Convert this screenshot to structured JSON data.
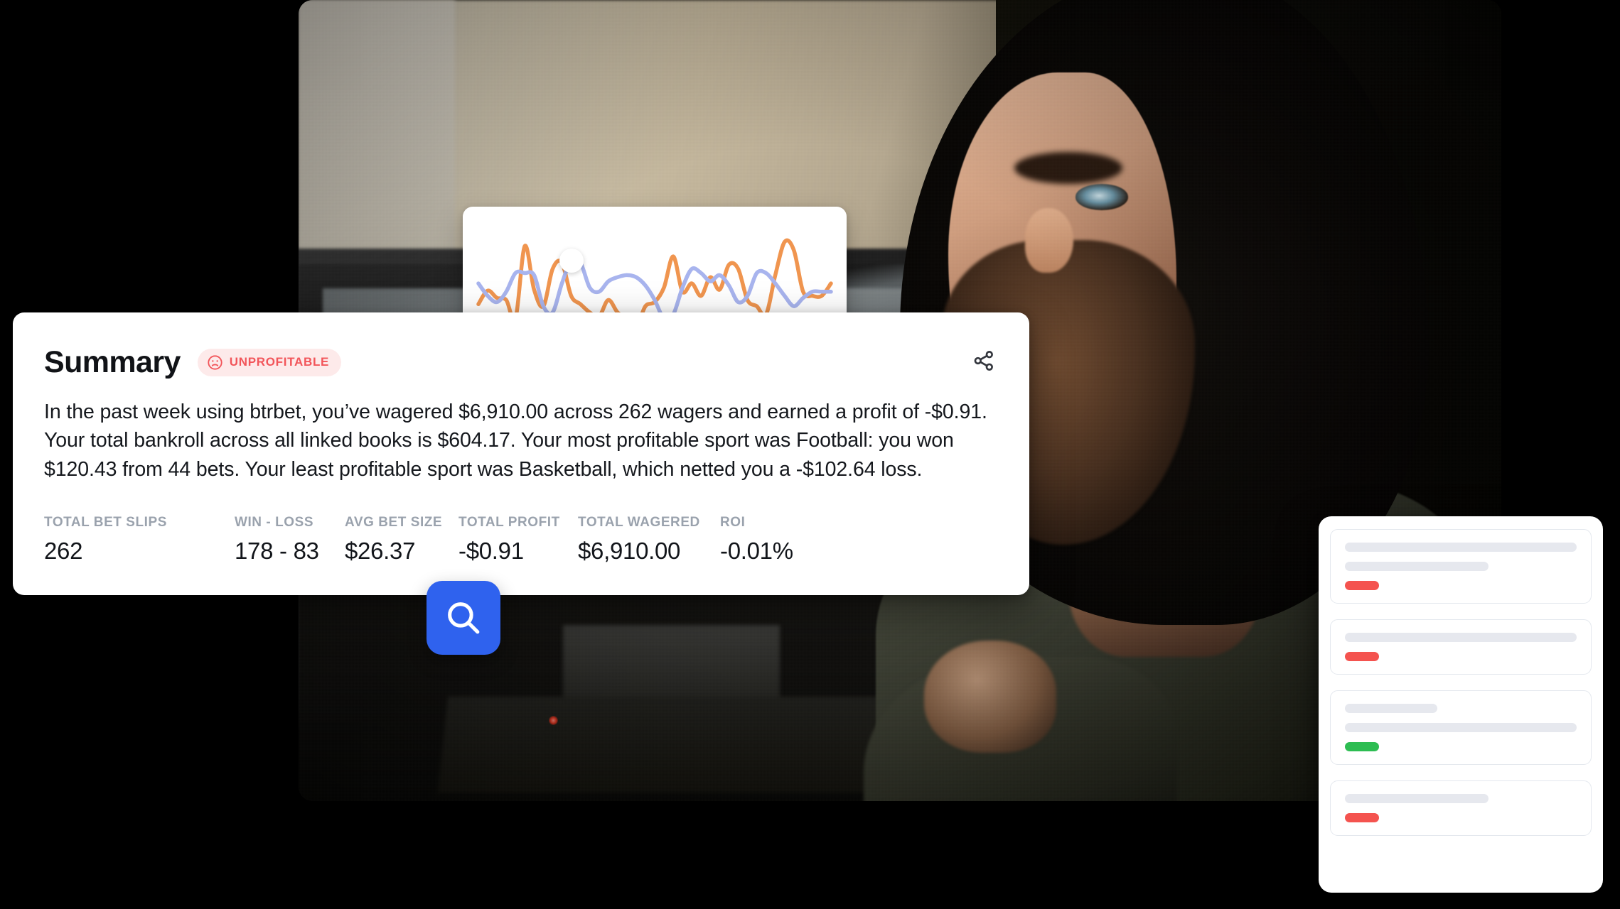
{
  "background": {
    "canvas_color": "#000000",
    "photo_alt": "blurred photo of a bearded man at a desk using a computer in a dim room"
  },
  "summary_card": {
    "title": "Summary",
    "badge": {
      "label": "UNPROFITABLE",
      "icon": "frowning-face-icon",
      "text_color": "#f2555a",
      "background_color": "#fdeaea"
    },
    "share_icon": "share-icon",
    "body": "In the past week using btrbet, you’ve wagered $6,910.00 across 262 wagers and earned a profit of -$0.91. Your total bankroll across all linked books is $604.17. Your most profitable sport was Football: you won $120.43 from 44 bets. Your least profitable sport was Basketball, which netted you a -$102.64 loss.",
    "stats": [
      {
        "label": "TOTAL BET SLIPS",
        "value": "262"
      },
      {
        "label": "WIN - LOSS",
        "value": "178 - 83"
      },
      {
        "label": "AVG BET SIZE",
        "value": "$26.37"
      },
      {
        "label": "TOTAL PROFIT",
        "value": "-$0.91"
      },
      {
        "label": "TOTAL WAGERED",
        "value": "$6,910.00"
      },
      {
        "label": "ROI",
        "value": "-0.01%"
      }
    ]
  },
  "search_button": {
    "icon": "search-icon",
    "background_color": "#2f62ee"
  },
  "list_card": {
    "items": [
      {
        "bars": [
          100,
          62
        ],
        "pill_color": "#f4534f"
      },
      {
        "bars": [
          100
        ],
        "pill_color": "#f4534f"
      },
      {
        "bars": [
          40,
          100
        ],
        "pill_color": "#2dbd52"
      },
      {
        "bars": [
          62
        ],
        "pill_color": "#f4534f"
      }
    ]
  },
  "chart_data": {
    "type": "line",
    "title": "",
    "subtitle": "",
    "xlabel": "",
    "ylabel": "",
    "grid": false,
    "legend": "none",
    "axis_visible": false,
    "marker": {
      "x_index": 10,
      "series": "series-2",
      "style": "white-dot"
    },
    "x": [
      0,
      1,
      2,
      3,
      4,
      5,
      6,
      7,
      8,
      9,
      10,
      11,
      12,
      13,
      14,
      15,
      16,
      17,
      18,
      19,
      20,
      21,
      22,
      23,
      24,
      25,
      26,
      27,
      28,
      29,
      30,
      31,
      32,
      33,
      34,
      35,
      36,
      37,
      38
    ],
    "series": [
      {
        "name": "series-1",
        "color": "#f0954f",
        "values": [
          32,
          45,
          38,
          36,
          18,
          88,
          46,
          30,
          66,
          72,
          40,
          32,
          24,
          20,
          36,
          24,
          18,
          10,
          30,
          34,
          48,
          78,
          44,
          52,
          40,
          58,
          46,
          70,
          66,
          36,
          30,
          22,
          60,
          92,
          84,
          44,
          40,
          40,
          52
        ]
      },
      {
        "name": "series-2",
        "color": "#a8b4ee",
        "values": [
          52,
          40,
          34,
          44,
          62,
          62,
          60,
          30,
          24,
          52,
          74,
          72,
          48,
          44,
          54,
          58,
          60,
          58,
          50,
          36,
          18,
          22,
          48,
          66,
          62,
          54,
          60,
          50,
          34,
          40,
          62,
          62,
          52,
          40,
          30,
          38,
          44,
          44,
          44
        ]
      }
    ],
    "ylim": [
      0,
      100
    ],
    "xlim": [
      0,
      38
    ]
  }
}
